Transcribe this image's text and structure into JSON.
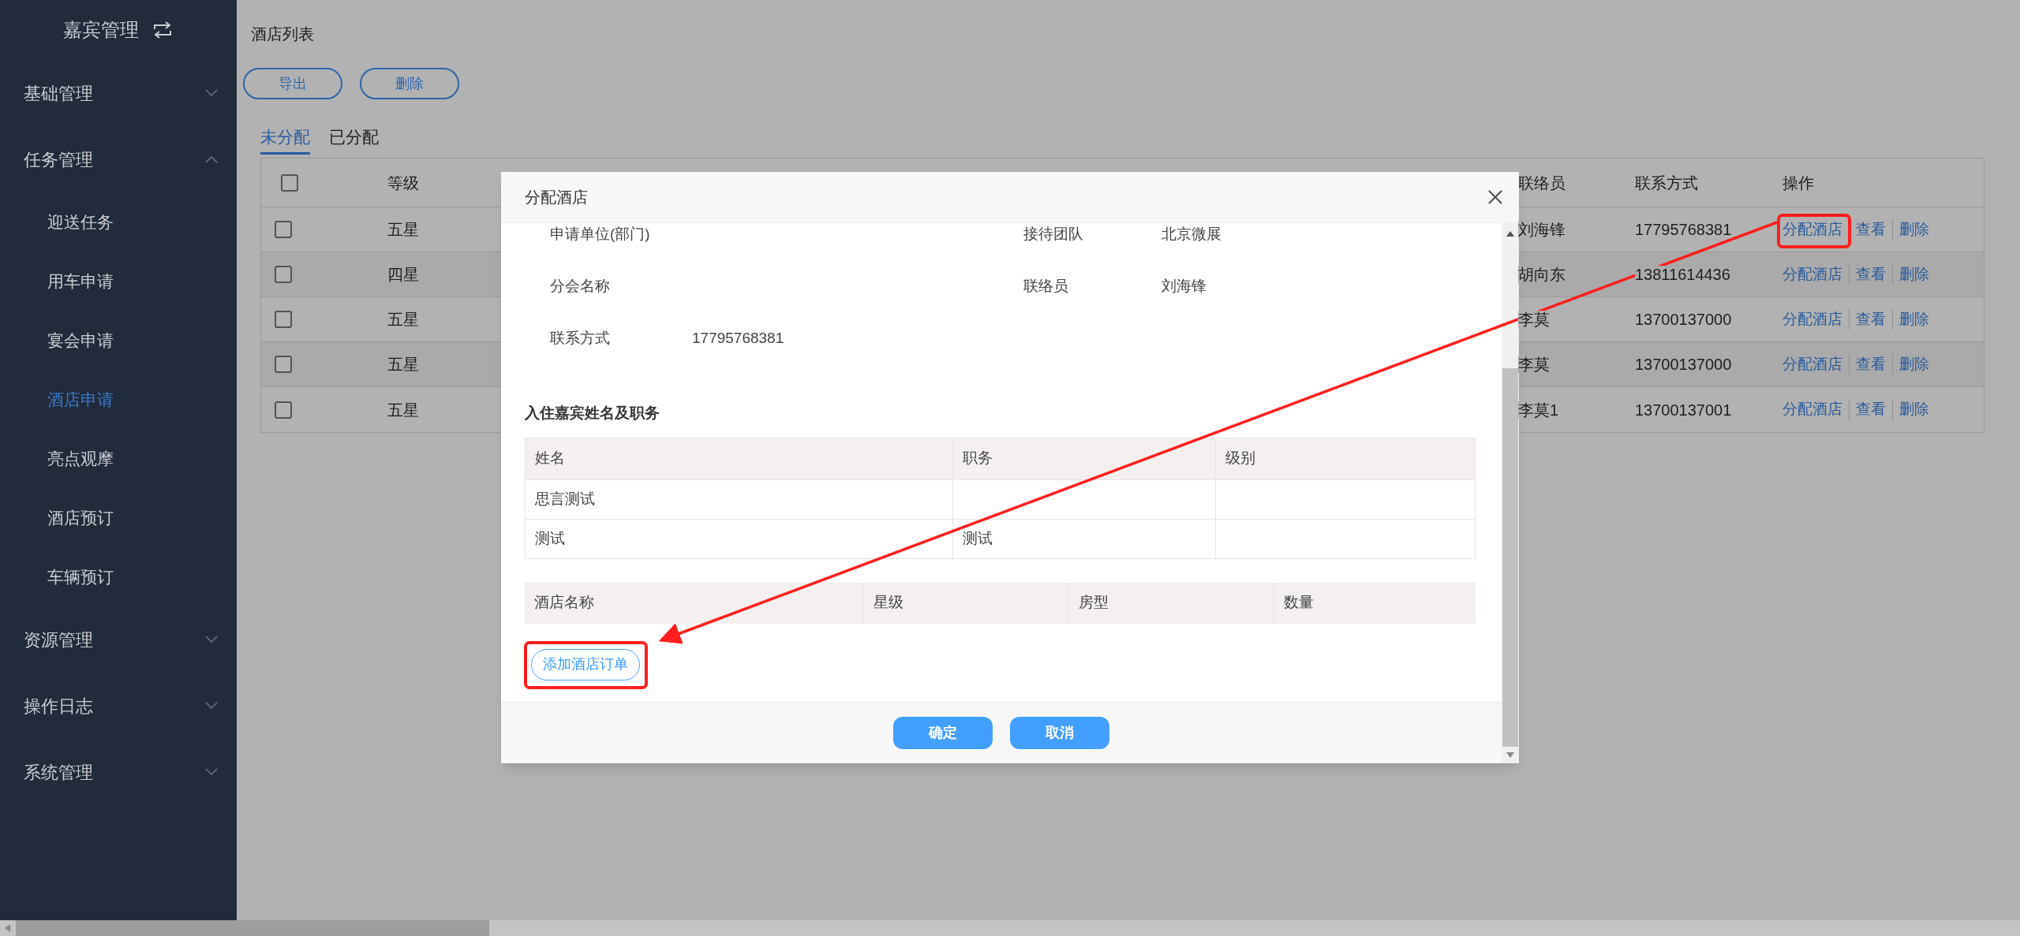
{
  "sidebar": {
    "title": "嘉宾管理",
    "items": [
      {
        "label": "基础管理",
        "expanded": false
      },
      {
        "label": "任务管理",
        "expanded": true,
        "children": [
          {
            "label": "迎送任务",
            "selected": false
          },
          {
            "label": "用车申请",
            "selected": false
          },
          {
            "label": "宴会申请",
            "selected": false
          },
          {
            "label": "酒店申请",
            "selected": true
          },
          {
            "label": "亮点观摩",
            "selected": false
          },
          {
            "label": "酒店预订",
            "selected": false
          },
          {
            "label": "车辆预订",
            "selected": false
          }
        ]
      },
      {
        "label": "资源管理",
        "expanded": false
      },
      {
        "label": "操作日志",
        "expanded": false
      },
      {
        "label": "系统管理",
        "expanded": false
      }
    ]
  },
  "page": {
    "title": "酒店列表",
    "buttons": [
      "导出",
      "删除"
    ]
  },
  "tabs": [
    {
      "label": "未分配",
      "selected": true
    },
    {
      "label": "已分配",
      "selected": false
    }
  ],
  "table": {
    "all_checked": false,
    "columns": [
      "等级",
      "联络员",
      "联系方式",
      "操作"
    ],
    "rows": [
      {
        "checked": false,
        "grade": "五星",
        "contact": "刘海锋",
        "phone": "17795768381",
        "actions": [
          "分配酒店",
          "查看",
          "删除"
        ]
      },
      {
        "checked": false,
        "grade": "四星",
        "contact": "胡向东",
        "phone": "13811614436",
        "actions": [
          "分配酒店",
          "查看",
          "删除"
        ]
      },
      {
        "checked": false,
        "grade": "五星",
        "contact": "李莫",
        "phone": "13700137000",
        "actions": [
          "分配酒店",
          "查看",
          "删除"
        ]
      },
      {
        "checked": false,
        "grade": "五星",
        "contact": "李莫",
        "phone": "13700137000",
        "actions": [
          "分配酒店",
          "查看",
          "删除"
        ]
      },
      {
        "checked": false,
        "grade": "五星",
        "contact": "李莫1",
        "phone": "13700137001",
        "actions": [
          "分配酒店",
          "查看",
          "删除"
        ]
      }
    ]
  },
  "dialog": {
    "title": "分配酒店",
    "info_rows": [
      [
        {
          "label": "申请单位(部门)"
        },
        {
          "label": "接待团队",
          "value": "北京微展"
        }
      ],
      [
        {
          "label": "分会名称"
        },
        {
          "label": "联络员",
          "value": "刘海锋"
        }
      ],
      [
        {
          "label": "联系方式",
          "value": "17795768381"
        }
      ]
    ],
    "guests_title": "入住嘉宾姓名及职务",
    "guests": {
      "columns": [
        "姓名",
        "职务",
        "级别"
      ],
      "rows": [
        {
          "name": "思言测试"
        },
        {
          "name": "测试",
          "position": "测试"
        }
      ]
    },
    "hotels": {
      "columns": [
        "酒店名称",
        "星级",
        "房型",
        "数量"
      ]
    },
    "add_button": "添加酒店订单",
    "buttons": [
      "确定",
      "取消"
    ]
  }
}
